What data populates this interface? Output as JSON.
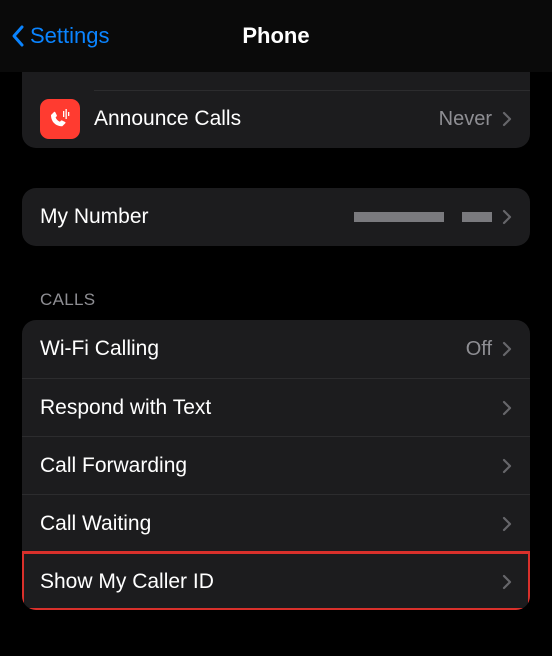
{
  "nav": {
    "back_label": "Settings",
    "title": "Phone"
  },
  "top_group": {
    "announce_calls": {
      "label": "Announce Calls",
      "value": "Never"
    }
  },
  "my_number": {
    "label": "My Number"
  },
  "calls_header": "CALLS",
  "calls": {
    "wifi_calling": {
      "label": "Wi-Fi Calling",
      "value": "Off"
    },
    "respond_with_text": {
      "label": "Respond with Text"
    },
    "call_forwarding": {
      "label": "Call Forwarding"
    },
    "call_waiting": {
      "label": "Call Waiting"
    },
    "show_my_caller_id": {
      "label": "Show My Caller ID"
    }
  }
}
